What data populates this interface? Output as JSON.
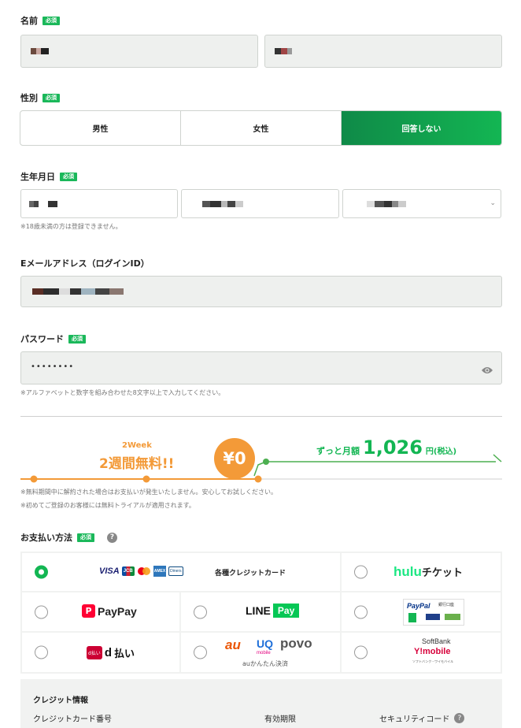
{
  "required_badge": "必須",
  "name": {
    "label": "名前"
  },
  "gender": {
    "label": "性別",
    "options": [
      "男性",
      "女性",
      "回答しない"
    ],
    "selected": "回答しない"
  },
  "birthday": {
    "label": "生年月日",
    "note": "※18歳未満の方は登録できません。"
  },
  "email": {
    "label": "Eメールアドレス（ログインID）"
  },
  "password": {
    "label": "パスワード",
    "value": "••••••••",
    "note": "※アルファベットと数字を組み合わせた8文字以上で入力してください。"
  },
  "plan": {
    "trial_week": "2Week",
    "trial_label": "2週間無料!!",
    "zero_price": "¥0",
    "monthly_prefix": "ずっと月額",
    "monthly_amount": "1,026",
    "monthly_suffix": "円(税込)",
    "note1": "※無料期間中に解約された場合はお支払いが発生いたしません。安心してお試しください。",
    "note2": "※初めてご登録のお客様には無料トライアルが適用されます。"
  },
  "payment": {
    "label": "お支払い方法",
    "help_icon": "question-circle-icon",
    "card_label": "各種クレジットカード",
    "card_brands": [
      "VISA",
      "JCB",
      "MC",
      "AMEX",
      "Diners"
    ],
    "hulu_ticket_a": "hulu",
    "hulu_ticket_b": "チケット",
    "paypay": "PayPay",
    "line": "LINE",
    "line_pay": "Pay",
    "paypal_top": "PayPal",
    "paypal_sub": "銀行口座",
    "dpay_box": "d払い",
    "dpay": "払い",
    "au": "au",
    "uq": "UQ",
    "uq_sub": "mobile",
    "povo": "povo",
    "au_sub": "auかんたん決済",
    "softbank": "SoftBank",
    "ymobile": "Y!mobile",
    "softbank_sub": "ソフトバンク・ワイモバイル"
  },
  "credit": {
    "title": "クレジット情報",
    "card_number": "クレジットカード番号",
    "expiry": "有効期限",
    "security": "セキュリティコード"
  },
  "colors": {
    "accent": "#13b653",
    "orange": "#f39a38",
    "green_line": "#4caf50"
  }
}
